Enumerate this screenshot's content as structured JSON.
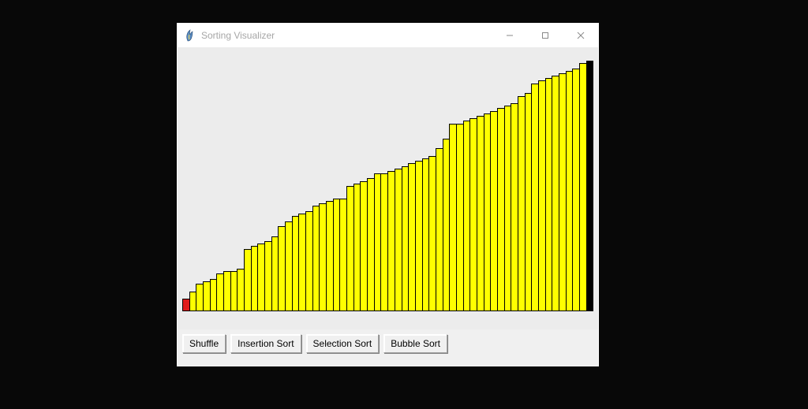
{
  "window": {
    "title": "Sorting Visualizer"
  },
  "buttons": {
    "shuffle": "Shuffle",
    "insertion": "Insertion Sort",
    "selection": "Selection Sort",
    "bubble": "Bubble Sort"
  },
  "chart_data": {
    "type": "bar",
    "title": "",
    "xlabel": "",
    "ylabel": "",
    "ylim": [
      0,
      100
    ],
    "values": [
      5,
      8,
      11,
      12,
      13,
      15,
      16,
      16,
      17,
      25,
      26,
      27,
      28,
      30,
      34,
      36,
      38,
      39,
      40,
      42,
      43,
      44,
      45,
      45,
      50,
      51,
      52,
      53,
      55,
      55,
      56,
      57,
      58,
      59,
      60,
      61,
      62,
      65,
      69,
      75,
      75,
      76,
      77,
      78,
      79,
      80,
      81,
      82,
      83,
      86,
      87,
      91,
      92,
      93,
      94,
      95,
      96,
      97,
      99,
      100
    ],
    "colors": [
      "red",
      "yellow",
      "yellow",
      "yellow",
      "yellow",
      "yellow",
      "yellow",
      "yellow",
      "yellow",
      "yellow",
      "yellow",
      "yellow",
      "yellow",
      "yellow",
      "yellow",
      "yellow",
      "yellow",
      "yellow",
      "yellow",
      "yellow",
      "yellow",
      "yellow",
      "yellow",
      "yellow",
      "yellow",
      "yellow",
      "yellow",
      "yellow",
      "yellow",
      "yellow",
      "yellow",
      "yellow",
      "yellow",
      "yellow",
      "yellow",
      "yellow",
      "yellow",
      "yellow",
      "yellow",
      "yellow",
      "yellow",
      "yellow",
      "yellow",
      "yellow",
      "yellow",
      "yellow",
      "yellow",
      "yellow",
      "yellow",
      "yellow",
      "yellow",
      "yellow",
      "yellow",
      "yellow",
      "yellow",
      "yellow",
      "yellow",
      "yellow",
      "yellow",
      "black"
    ],
    "color_map": {
      "red": "#e01b1b",
      "yellow": "#ffff00",
      "black": "#000000"
    }
  }
}
